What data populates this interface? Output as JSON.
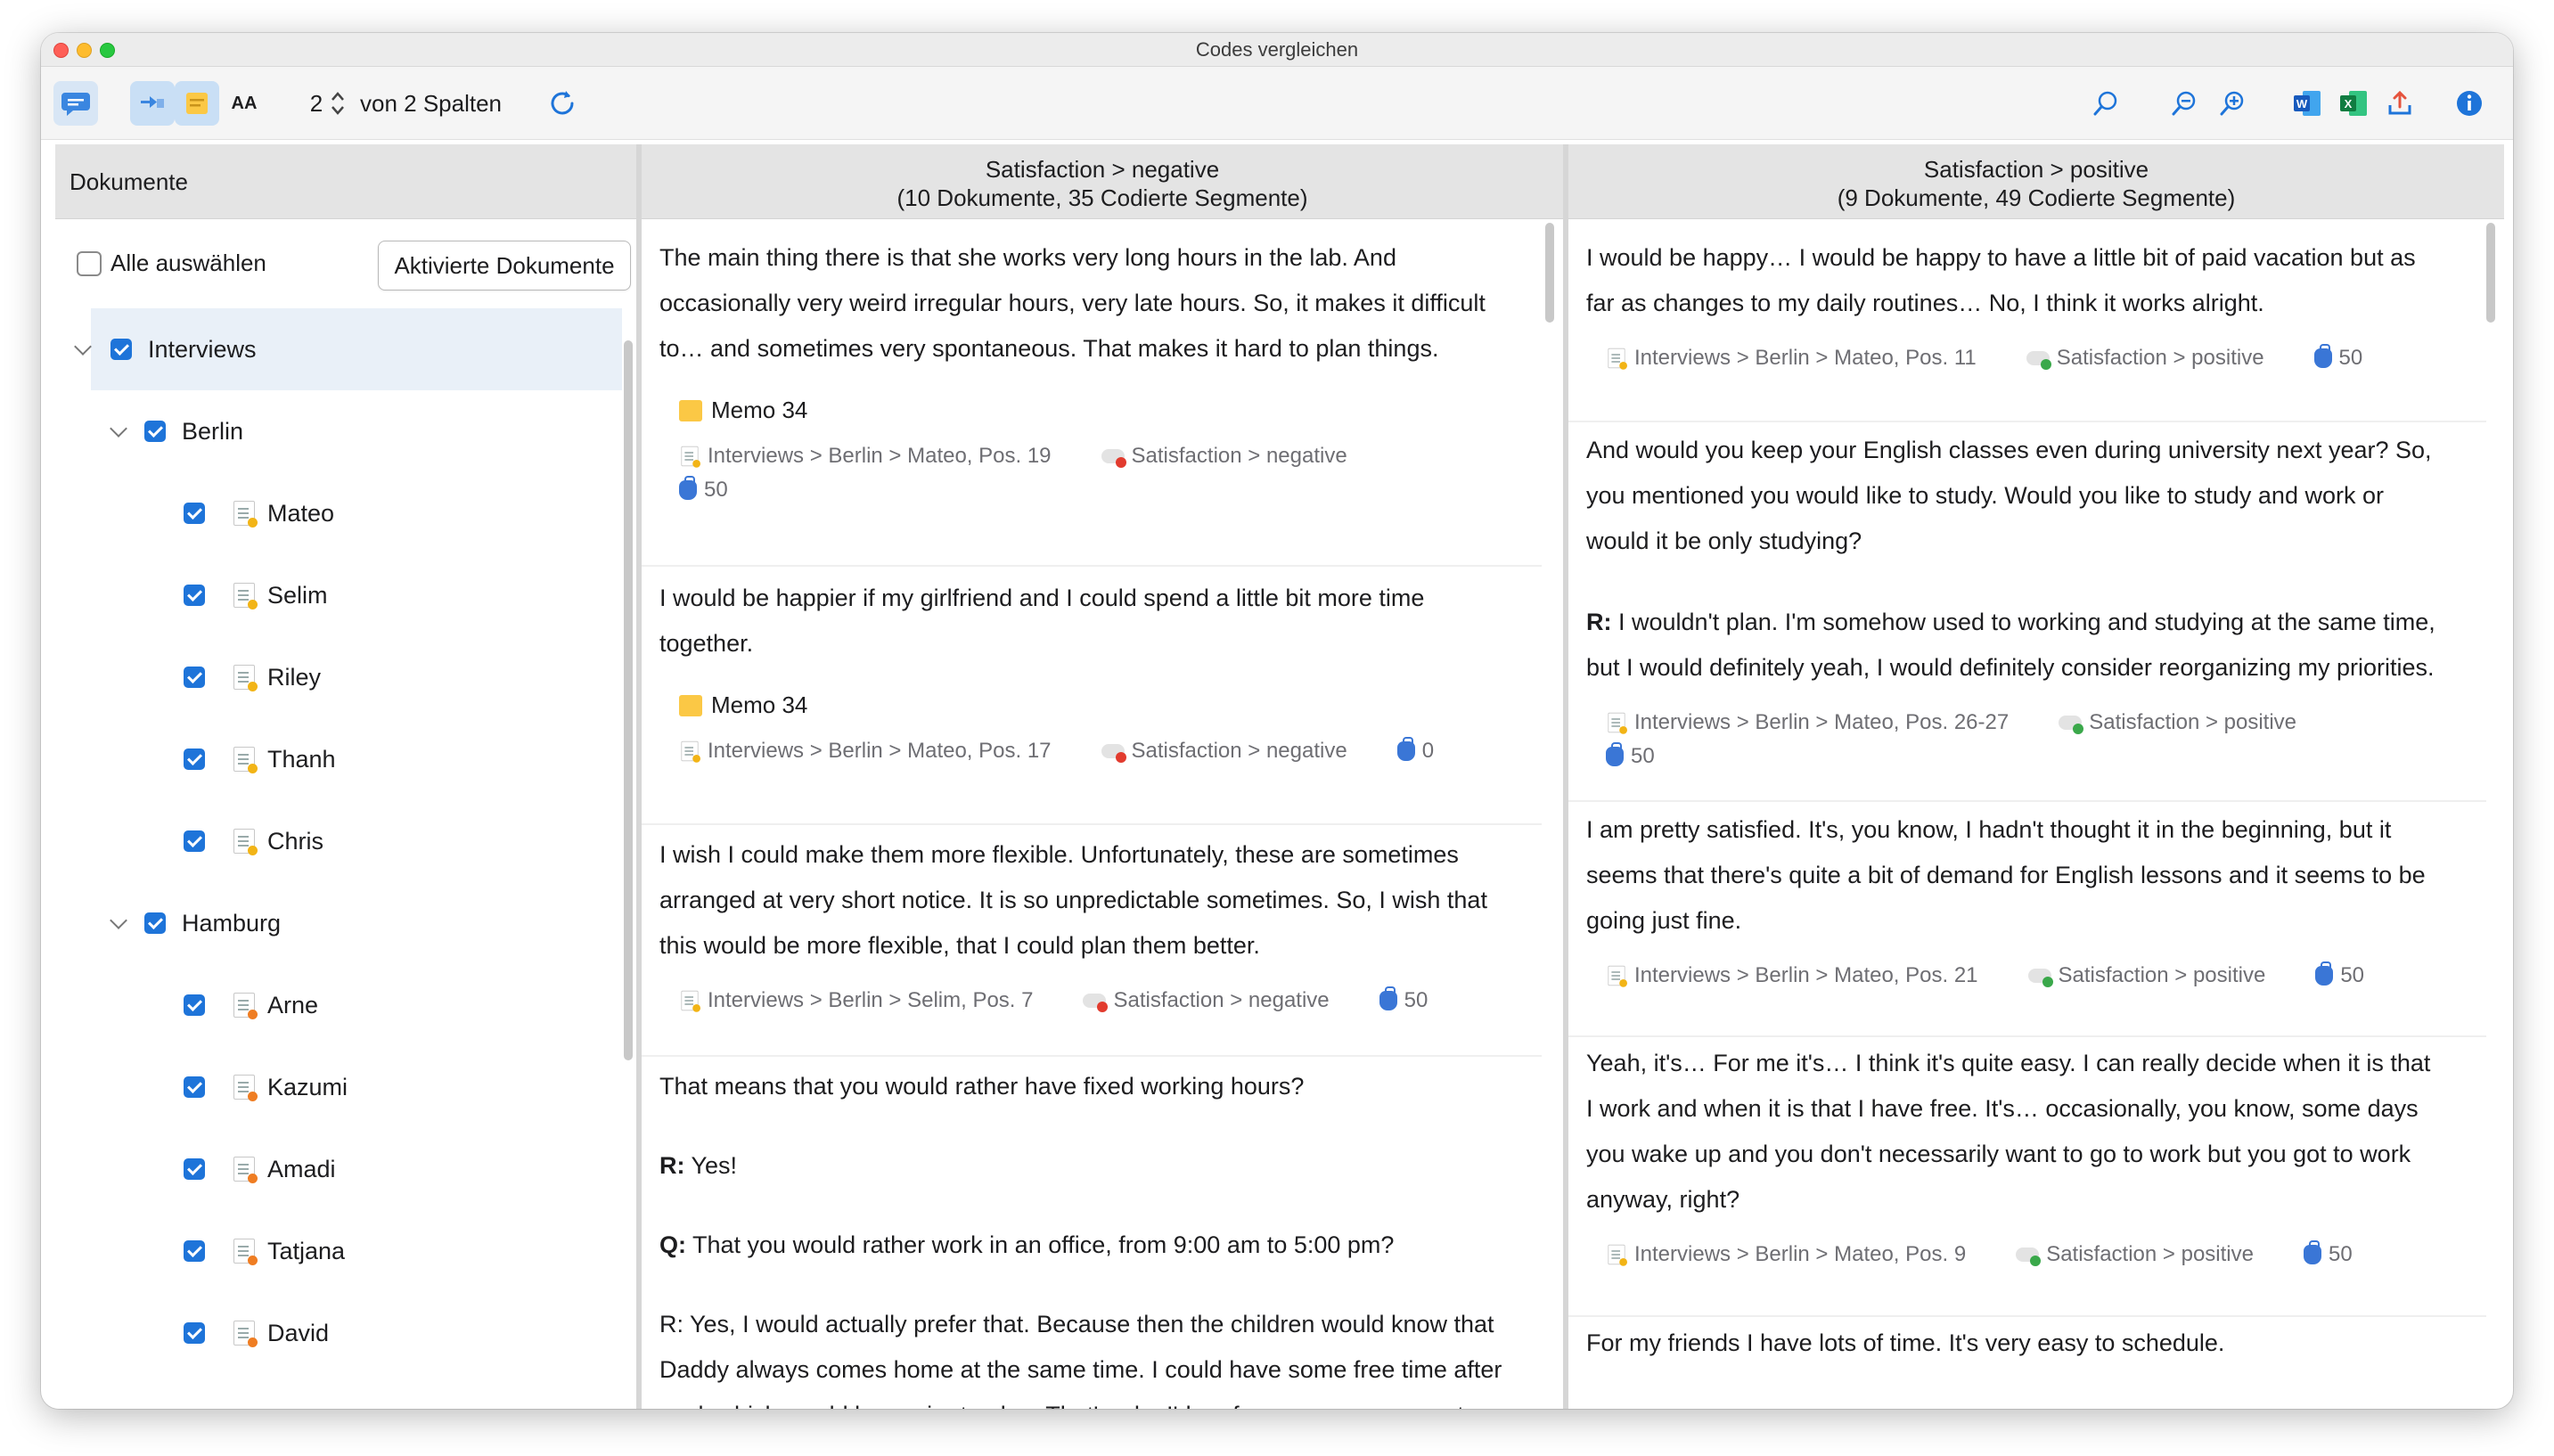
{
  "window": {
    "title": "Codes vergleichen"
  },
  "toolbar": {
    "columns_value": "2",
    "columns_label": "von 2 Spalten",
    "font_size_label": "AA",
    "icons": [
      "chat-bubble-icon",
      "code-highlight-icon",
      "memo-icon",
      "font-size-icon",
      "refresh-icon",
      "search-icon",
      "zoom-out-icon",
      "zoom-in-icon",
      "word-export-icon",
      "excel-export-icon",
      "export-icon",
      "info-icon"
    ]
  },
  "documents": {
    "header": "Dokumente",
    "select_all_label": "Alle auswählen",
    "activated_button": "Aktivierte Dokumente",
    "groups": [
      {
        "label": "Interviews"
      },
      {
        "label": "Berlin"
      },
      {
        "label": "Hamburg"
      }
    ],
    "berlin_docs": [
      "Mateo",
      "Selim",
      "Riley",
      "Thanh",
      "Chris"
    ],
    "hamburg_docs": [
      "Arne",
      "Kazumi",
      "Amadi",
      "Tatjana",
      "David"
    ]
  },
  "columns": [
    {
      "title": "Satisfaction > negative",
      "subtitle": "(10 Dokumente, 35 Codierte Segmente)",
      "segments": [
        {
          "lines": [
            "The main thing there is that she works very long hours in the lab. And",
            "occasionally very weird irregular hours, very late hours. So, it makes it difficult",
            "to… and sometimes very spontaneous. That makes it hard to plan things."
          ],
          "memo": "Memo 34",
          "source": "Interviews > Berlin > Mateo, Pos. 19",
          "code": "Satisfaction > negative",
          "weight": "50"
        },
        {
          "lines": [
            "I would be happier if my girlfriend and I could spend a little bit more time",
            "together."
          ],
          "memo": "Memo 34",
          "source": "Interviews > Berlin > Mateo, Pos. 17",
          "code": "Satisfaction > negative",
          "weight": "0"
        },
        {
          "lines": [
            "I wish I could make them more flexible. Unfortunately, these are sometimes",
            "arranged at very short notice. It is so unpredictable sometimes. So, I wish that",
            "this would be more flexible, that I could plan them better."
          ],
          "source": "Interviews > Berlin > Selim, Pos. 7",
          "code": "Satisfaction > negative",
          "weight": "50"
        },
        {
          "q1": "That means that you would rather have fixed working hours?",
          "r1_prefix": "R:",
          "r1": " Yes!",
          "q2_prefix": "Q:",
          "q2": " That you would rather work in an office, from 9:00 am to 5:00 pm?",
          "lines": [
            "R: Yes, I would actually prefer that. Because then the children would know that",
            "Daddy always comes home at the same time. I could have some free time after",
            "work which would be easier to plan. That's why I'd prefer a more permanent"
          ]
        }
      ]
    },
    {
      "title": "Satisfaction > positive",
      "subtitle": "(9 Dokumente, 49 Codierte Segmente)",
      "segments": [
        {
          "lines": [
            "I would be happy… I would be happy to have a little bit of paid vacation but as",
            "far as changes to my daily routines… No, I think it works alright."
          ],
          "source": "Interviews > Berlin > Mateo, Pos. 11",
          "code": "Satisfaction > positive",
          "weight": "50"
        },
        {
          "lines": [
            "And would you keep your English classes even during university next year? So,",
            "you mentioned you would like to study. Would you like to study and work or",
            "would it be only studying?"
          ],
          "r_prefix": "R:",
          "r_lines": [
            " I wouldn't plan. I'm somehow used to working and studying at the same time,",
            "but I would definitely yeah, I would definitely consider reorganizing my priorities."
          ],
          "source": "Interviews > Berlin > Mateo, Pos. 26-27",
          "code": "Satisfaction > positive",
          "weight": "50"
        },
        {
          "lines": [
            "I am pretty satisfied. It's, you know, I hadn't thought it in the beginning, but it",
            "seems that there's quite a bit of demand for English lessons and it seems to be",
            "going just fine."
          ],
          "source": "Interviews > Berlin > Mateo, Pos. 21",
          "code": "Satisfaction > positive",
          "weight": "50"
        },
        {
          "lines": [
            "Yeah, it's… For me it's… I think it's quite easy. I can really decide when it is that",
            "I work and when it is that I have free. It's… occasionally, you know, some days",
            "you wake up and you don't necessarily want to go to work but you got to work",
            "anyway, right?"
          ],
          "source": "Interviews > Berlin > Mateo, Pos. 9",
          "code": "Satisfaction > positive",
          "weight": "50"
        },
        {
          "lines": [
            "For my friends I have lots of time. It's very easy to schedule."
          ]
        }
      ]
    }
  ],
  "colors": {
    "accent": "#1e74d9",
    "negative_dot": "#e23b2e",
    "positive_dot": "#3aa84a",
    "memo_yellow": "#fbc845"
  }
}
